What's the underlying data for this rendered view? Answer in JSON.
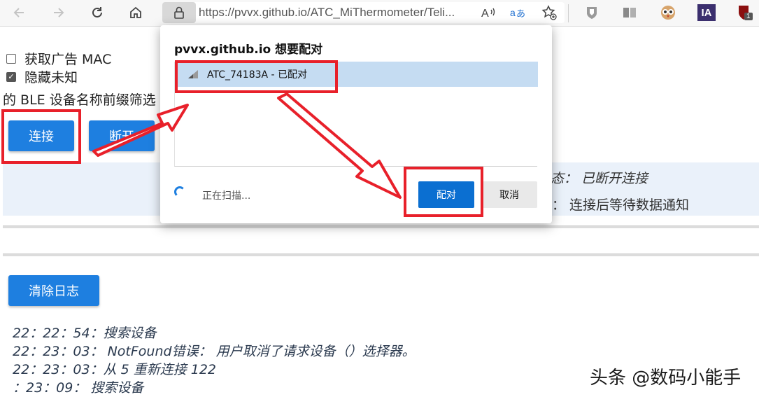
{
  "browser": {
    "url": "https://pvvx.github.io/ATC_MiThermometer/Teli...",
    "icons": [
      "back-icon",
      "forward-icon",
      "refresh-icon",
      "home-icon",
      "lock-icon",
      "read-aloud-icon",
      "translate-icon",
      "favorite-add-icon",
      "shield-extension-icon",
      "reader-extension-icon",
      "owl-extension-icon",
      "ia-extension-icon",
      "ublock-extension-icon"
    ],
    "ext_ia_label": "IA",
    "ext_ublock_badge": "1"
  },
  "page": {
    "checkbox_mac": {
      "label": "获取广告 MAC",
      "checked": false
    },
    "checkbox_hide": {
      "label": "隐藏未知",
      "checked": true
    },
    "prefix_text": "的 BLE 设备名称前缀筛选",
    "connect_label": "连接",
    "disconnect_label": "断开",
    "status_line1": "态：  已断开连接",
    "status_line2": "：  连接后等待数据通知",
    "clear_log_label": "清除日志",
    "log_lines": [
      "22：22：54：搜索设备",
      "22：23：03：  NotFound错误：  用户取消了请求设备（）选择器。",
      "22：23：03：从 5 重新连接 122",
      "：23：09：  搜索设备"
    ],
    "watermark": "头条 @数码小能手"
  },
  "dialog": {
    "title": "pvvx.github.io 想要配对",
    "device_label": "ATC_74183A - 已配对",
    "scanning_label": "正在扫描...",
    "pair_label": "配对",
    "cancel_label": "取消"
  },
  "colors": {
    "accent": "#1e7fe0",
    "annotation_red": "#e8202a",
    "selection": "#c5dcf2",
    "status_band": "#eaf1fa"
  }
}
